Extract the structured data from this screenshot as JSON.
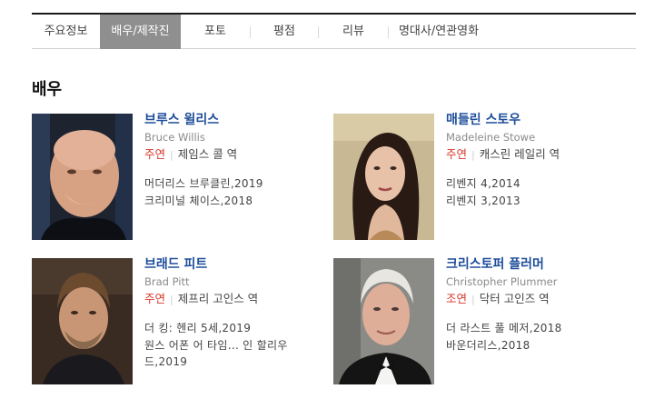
{
  "tabs": [
    {
      "label": "주요정보",
      "active": false
    },
    {
      "label": "배우/제작진",
      "active": true
    },
    {
      "label": "포토",
      "active": false
    },
    {
      "label": "평점",
      "active": false
    },
    {
      "label": "리뷰",
      "active": false
    },
    {
      "label": "명대사/연관영화",
      "active": false
    }
  ],
  "section": {
    "title": "배우"
  },
  "actors": [
    {
      "name_ko": "브루스 윌리스",
      "name_en": "Bruce Willis",
      "role_type": "주연",
      "role_name": "제임스 콜 역",
      "films": [
        "머더리스 브루클린,2019",
        "크리미널 체이스,2018"
      ]
    },
    {
      "name_ko": "매들린 스토우",
      "name_en": "Madeleine Stowe",
      "role_type": "주연",
      "role_name": "캐스린 레일리 역",
      "films": [
        "리벤지 4,2014",
        "리벤지 3,2013"
      ]
    },
    {
      "name_ko": "브래드 피트",
      "name_en": "Brad Pitt",
      "role_type": "주연",
      "role_name": "제프리 고인스 역",
      "films": [
        "더 킹: 헨리 5세,2019",
        "원스 어폰 어 타임... 인 할리우드,2019"
      ]
    },
    {
      "name_ko": "크리스토퍼 플러머",
      "name_en": "Christopher Plummer",
      "role_type": "조연",
      "role_name": "닥터 고인즈 역",
      "films": [
        "더 라스트 풀 메저,2018",
        "바운더리스,2018"
      ]
    }
  ],
  "colors": {
    "active_tab_bg": "#8f8f8f",
    "name_link": "#1e4d9a",
    "role_type": "#d9362b"
  }
}
